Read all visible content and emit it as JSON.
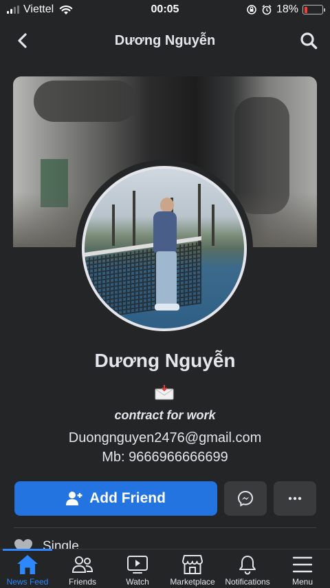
{
  "status_bar": {
    "carrier": "Viettel",
    "time": "00:05",
    "battery_percent": "18%",
    "battery_level": 0.18
  },
  "header": {
    "title": "Dương Nguyễn",
    "back_icon": "chevron-left-icon",
    "search_icon": "search-icon"
  },
  "profile": {
    "name": "Dương Nguyễn",
    "bio_emoji": "📩",
    "bio_line": "contract for work",
    "email": "Duongnguyen2476@gmail.com",
    "phone": "Mb: 9666966666699"
  },
  "actions": {
    "add_friend_label": "Add Friend",
    "messenger_icon": "messenger-icon",
    "more_icon": "more-icon"
  },
  "details": {
    "relationship": "Single",
    "relationship_icon": "heart-icon"
  },
  "bottom_nav": {
    "items": [
      {
        "label": "News Feed",
        "icon": "home-icon",
        "active": true
      },
      {
        "label": "Friends",
        "icon": "friends-icon",
        "active": false
      },
      {
        "label": "Watch",
        "icon": "watch-icon",
        "active": false
      },
      {
        "label": "Marketplace",
        "icon": "marketplace-icon",
        "active": false
      },
      {
        "label": "Notifications",
        "icon": "bell-icon",
        "active": false
      },
      {
        "label": "Menu",
        "icon": "menu-icon",
        "active": false
      }
    ]
  },
  "colors": {
    "background": "#242526",
    "primary_blue": "#2374e1",
    "active_blue": "#2d88ff",
    "secondary_button": "#3a3b3c",
    "text": "#e4e6eb"
  }
}
